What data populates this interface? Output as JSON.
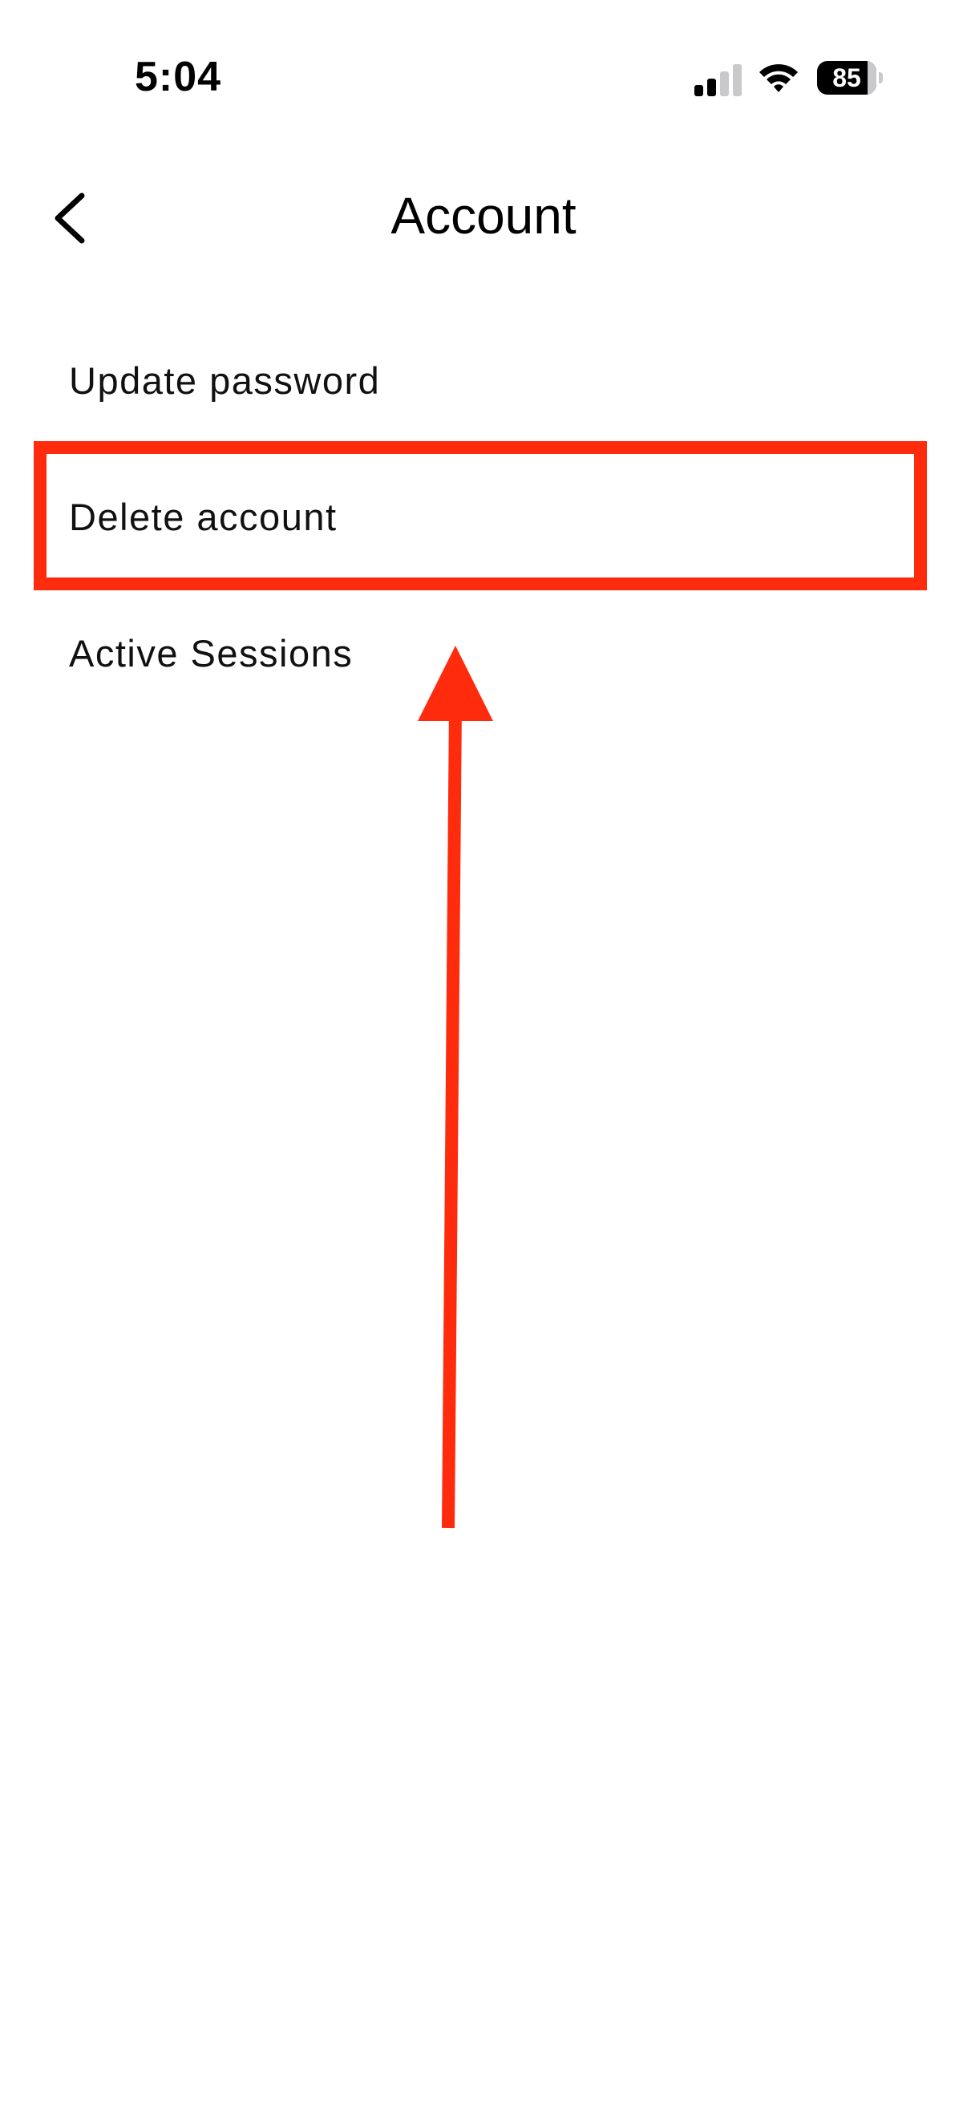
{
  "status_bar": {
    "time": "5:04",
    "battery_percent": "85",
    "battery_level": 0.85,
    "signal_bars_active": 2,
    "signal_bars_total": 4,
    "icons": [
      "signal-icon",
      "wifi-icon",
      "battery-icon"
    ]
  },
  "header": {
    "back_icon": "chevron-left-icon",
    "title": "Account"
  },
  "menu": {
    "items": [
      {
        "label": "Update password"
      },
      {
        "label": "Delete account"
      },
      {
        "label": "Active Sessions"
      }
    ]
  },
  "annotation": {
    "color": "#fe2b0d",
    "highlighted_item": "Delete account",
    "arrow_icon": "arrow-up-icon"
  }
}
